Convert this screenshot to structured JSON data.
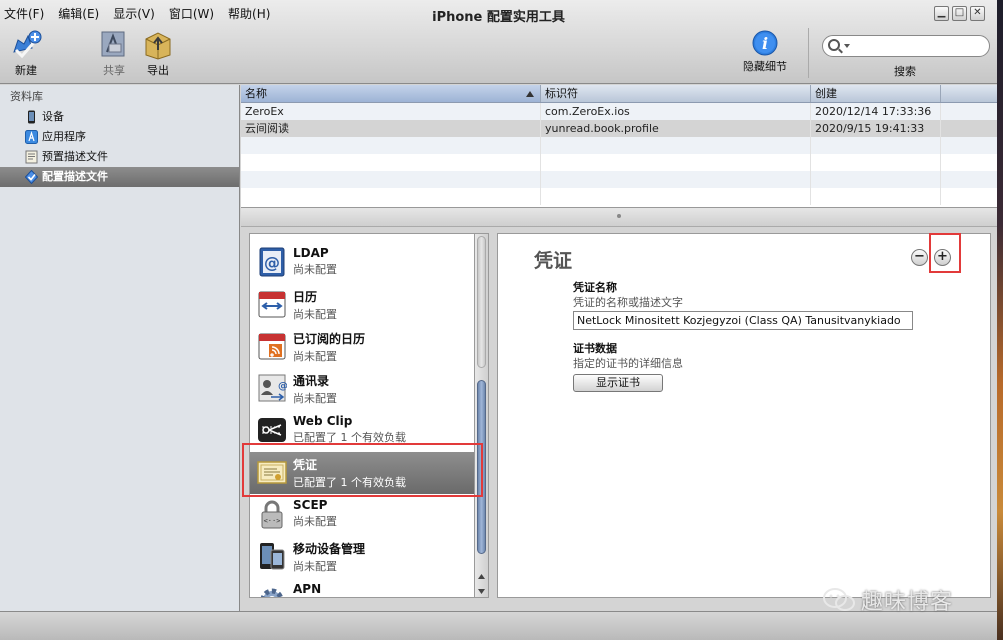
{
  "menubar": [
    "文件(F)",
    "编辑(E)",
    "显示(V)",
    "窗口(W)",
    "帮助(H)"
  ],
  "window_title": "iPhone 配置实用工具",
  "toolbar": {
    "new_label": "新建",
    "share_label": "共享",
    "export_label": "导出",
    "hide_details_label": "隐藏细节",
    "search_label": "搜索",
    "search_value": ""
  },
  "sidebar": {
    "header": "资料库",
    "items": [
      {
        "label": "设备",
        "icon": "device-icon"
      },
      {
        "label": "应用程序",
        "icon": "app-store-icon"
      },
      {
        "label": "预置描述文件",
        "icon": "provisioning-profile-icon"
      },
      {
        "label": "配置描述文件",
        "icon": "configuration-profile-icon",
        "selected": true
      }
    ]
  },
  "table": {
    "columns": [
      "名称",
      "标识符",
      "创建"
    ],
    "rows": [
      {
        "name": "ZeroEx",
        "identifier": "com.ZeroEx.ios",
        "created": "2020/12/14 17:33:36"
      },
      {
        "name": "云间阅读",
        "identifier": "yunread.book.profile",
        "created": "2020/9/15 19:41:33",
        "selected": true
      }
    ]
  },
  "payloads": [
    {
      "name": "LDAP",
      "status": "尚未配置",
      "icon": "ldap-icon"
    },
    {
      "name": "日历",
      "status": "尚未配置",
      "icon": "calendar-icon"
    },
    {
      "name": "已订阅的日历",
      "status": "尚未配置",
      "icon": "subscribed-calendar-icon"
    },
    {
      "name": "通讯录",
      "status": "尚未配置",
      "icon": "contacts-icon"
    },
    {
      "name": "Web Clip",
      "status": "已配置了 1 个有效负载",
      "icon": "web-clip-icon"
    },
    {
      "name": "凭证",
      "status": "已配置了 1 个有效负载",
      "icon": "credential-icon",
      "selected": true
    },
    {
      "name": "SCEP",
      "status": "尚未配置",
      "icon": "scep-lock-icon"
    },
    {
      "name": "移动设备管理",
      "status": "尚未配置",
      "icon": "mdm-icon"
    },
    {
      "name": "APN",
      "status": "",
      "icon": "apn-gear-icon"
    }
  ],
  "detail": {
    "title": "凭证",
    "minus": "−",
    "plus": "+",
    "name_label": "凭证名称",
    "name_desc": "凭证的名称或描述文字",
    "name_value": "NetLock Minositett Kozjegyzoi (Class QA) Tanusitvanykiado",
    "data_label": "证书数据",
    "data_desc": "指定的证书的详细信息",
    "show_cert_button": "显示证书"
  },
  "watermark": "趣味博客",
  "colors": {
    "highlight_box": "#e23a3a",
    "selection_gray": "#7a7a7a",
    "scroll_thumb": "#7f97bd"
  }
}
